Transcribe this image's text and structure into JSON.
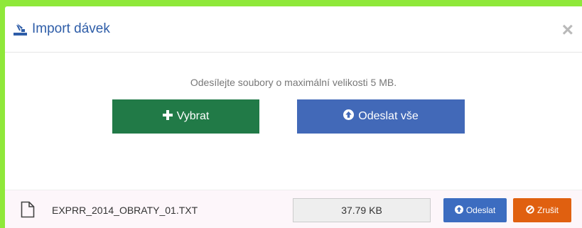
{
  "modal": {
    "title": "Import dávek",
    "title_icon": "import-icon",
    "close_label": "×"
  },
  "upload": {
    "hint": "Odesílejte soubory o maximální velikosti 5 MB.",
    "select_label": "Vybrat",
    "send_all_label": "Odeslat vše"
  },
  "file": {
    "name": "EXPRR_2014_OBRATY_01.TXT",
    "size": "37.79 KB",
    "send_label": "Odeslat",
    "cancel_label": "Zrušit"
  },
  "colors": {
    "select_button": "#217a47",
    "send_all_button": "#4269b8",
    "send_button": "#3c6cc0",
    "cancel_button": "#e06010",
    "title": "#2e5da8"
  }
}
